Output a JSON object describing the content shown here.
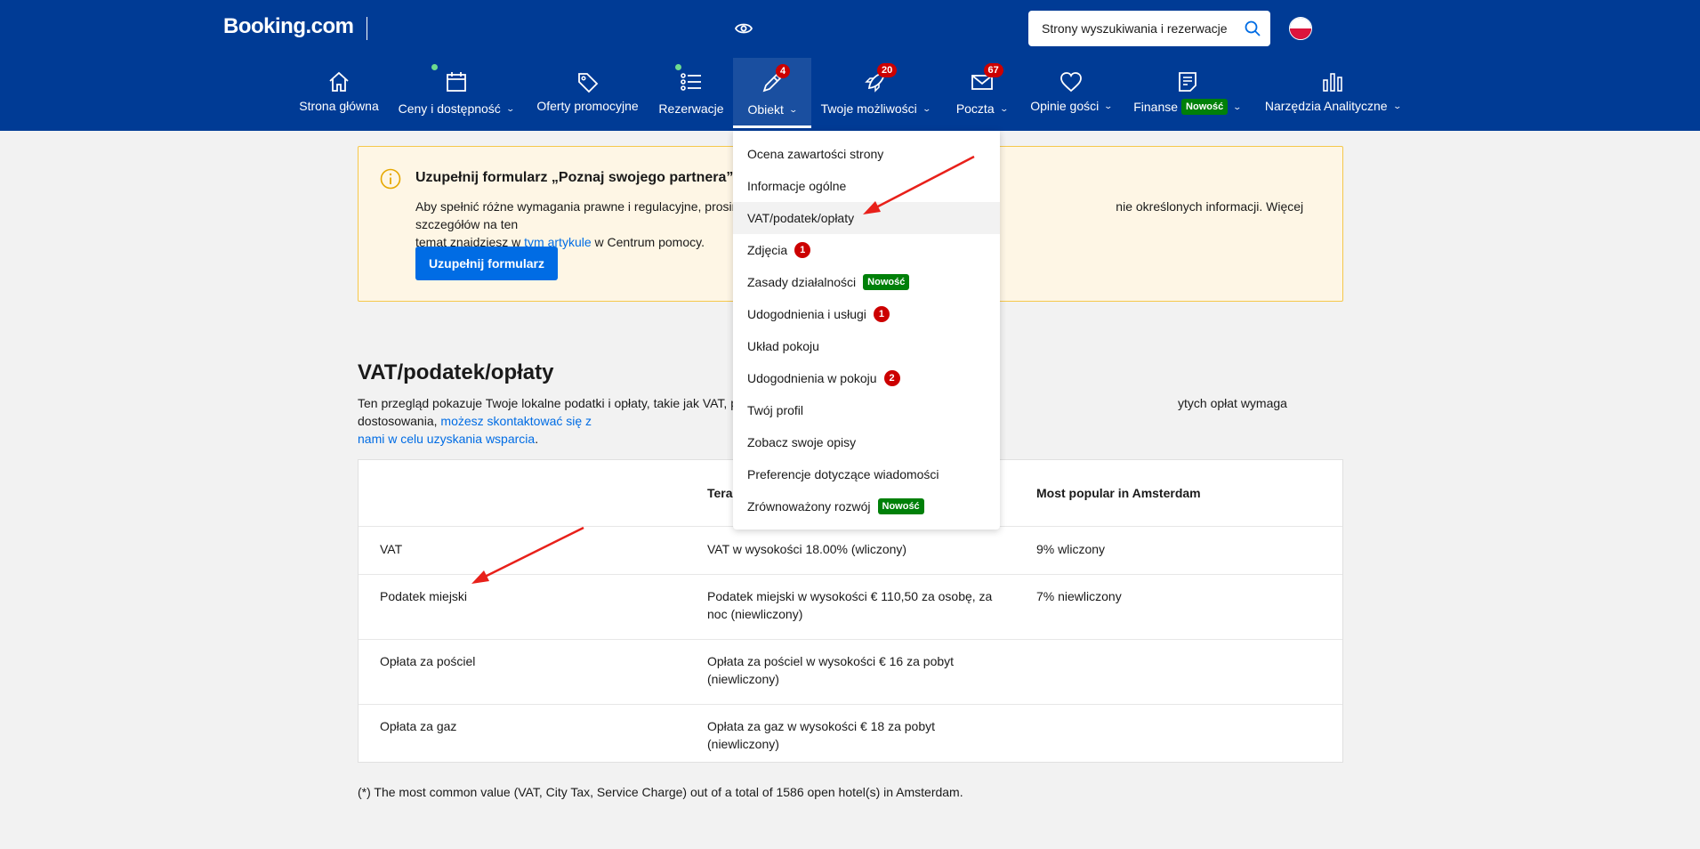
{
  "header": {
    "logo": "Booking.com",
    "search_placeholder": "Strony wyszukiwania i rezerwacje"
  },
  "nav": {
    "items": [
      {
        "label": "Strona główna",
        "icon": "home-icon"
      },
      {
        "label": "Ceny i dostępność",
        "icon": "calendar-icon"
      },
      {
        "label": "Oferty promocyjne",
        "icon": "tag-icon"
      },
      {
        "label": "Rezerwacje",
        "icon": "list-icon"
      },
      {
        "label": "Obiekt",
        "icon": "pencil-icon",
        "badge": "4"
      },
      {
        "label": "Twoje możliwości",
        "icon": "rocket-icon",
        "badge": "20"
      },
      {
        "label": "Poczta",
        "icon": "mail-icon",
        "badge": "67"
      },
      {
        "label": "Opinie gości",
        "icon": "heart-icon"
      },
      {
        "label": "Finanse",
        "icon": "document-icon",
        "new": "Nowość"
      },
      {
        "label": "Narzędzia Analityczne",
        "icon": "bar-chart-icon"
      }
    ]
  },
  "alert": {
    "title": "Uzupełnij formularz „Poznaj swojego partnera”",
    "body_part1": "Aby spełnić różne wymagania prawne i regulacyjne, prosim",
    "body_part2": "nie określonych informacji. Więcej szczegółów na ten",
    "body_part3": "temat znajdziesz w ",
    "link": "tym artykule",
    "body_part4": " w Centrum pomocy.",
    "button": "Uzupełnij formularz"
  },
  "section": {
    "title": "VAT/podatek/opłaty",
    "desc_part1": "Ten przegląd pokazuje Twoje lokalne podatki i opłaty, takie jak VAT, p",
    "desc_part2": "ytych opłat wymaga dostosowania, ",
    "desc_link1": "możesz skontaktować się z",
    "desc_link2": "nami w celu uzyskania wsparcia",
    "desc_end": "."
  },
  "table": {
    "headers": [
      "",
      "Teraz",
      "Most popular in Amsterdam"
    ],
    "rows": [
      {
        "name": "VAT",
        "now": "VAT w wysokości 18.00% (wliczony)",
        "popular": "9% wliczony"
      },
      {
        "name": "Podatek miejski",
        "now": "Podatek miejski w wysokości € 110,50 za osobę, za noc (niewliczony)",
        "popular": "7% niewliczony"
      },
      {
        "name": "Opłata za pościel",
        "now": "Opłata za pościel w wysokości € 16 za pobyt (niewliczony)",
        "popular": ""
      },
      {
        "name": "Opłata za gaz",
        "now": "Opłata za gaz w wysokości € 18 za pobyt (niewliczony)",
        "popular": ""
      }
    ]
  },
  "footnote": "(*) The most common value (VAT, City Tax, Service Charge) out of a total of 1586 open hotel(s) in Amsterdam.",
  "dropdown": {
    "items": [
      {
        "label": "Ocena zawartości strony"
      },
      {
        "label": "Informacje ogólne"
      },
      {
        "label": "VAT/podatek/opłaty",
        "highlight": true
      },
      {
        "label": "Zdjęcia",
        "count": "1"
      },
      {
        "label": "Zasady działalności",
        "new": "Nowość"
      },
      {
        "label": "Udogodnienia i usługi",
        "count": "1"
      },
      {
        "label": "Układ pokoju"
      },
      {
        "label": "Udogodnienia w pokoju",
        "count": "2"
      },
      {
        "label": "Twój profil"
      },
      {
        "label": "Zobacz swoje opisy"
      },
      {
        "label": "Preferencje dotyczące wiadomości"
      },
      {
        "label": "Zrównoważony rozwój",
        "new": "Nowość"
      }
    ]
  },
  "colors": {
    "header": "#003b95",
    "primary": "#006ce4",
    "badge_red": "#cc0000",
    "badge_green": "#008009",
    "alert_bg": "#fef6e5",
    "annotation_arrow": "#e8201a"
  }
}
